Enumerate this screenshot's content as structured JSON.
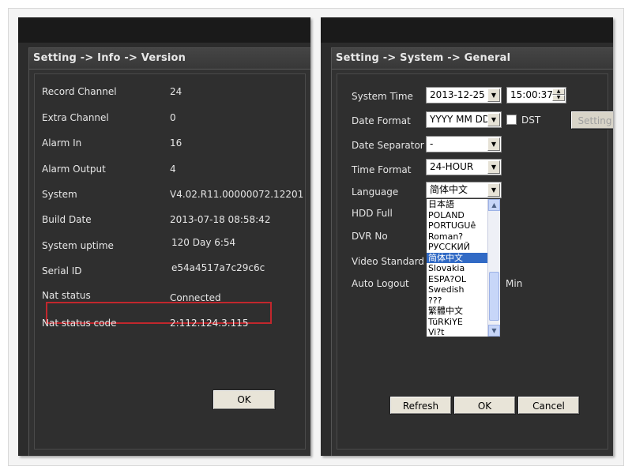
{
  "left_window": {
    "title": "Setting -> Info -> Version",
    "rows": [
      {
        "label": "Record Channel",
        "value": "24"
      },
      {
        "label": "Extra Channel",
        "value": "0"
      },
      {
        "label": "Alarm In",
        "value": "16"
      },
      {
        "label": "Alarm Output",
        "value": "4"
      },
      {
        "label": "System",
        "value": "V4.02.R11.00000072.12201"
      },
      {
        "label": "Build Date",
        "value": "2013-07-18 08:58:42"
      },
      {
        "label": "System uptime",
        "value": "120 Day 6:54"
      },
      {
        "label": "Serial ID",
        "value": "e54a4517a7c29c6c"
      },
      {
        "label": "Nat status",
        "value": "Connected"
      },
      {
        "label": "Nat status code",
        "value": "2:112.124.3.115"
      }
    ],
    "ok_label": "OK",
    "highlight_color": "#c2272d"
  },
  "right_window": {
    "title": "Setting -> System -> General",
    "labels": {
      "system_time": "System Time",
      "date_format": "Date Format",
      "date_separator": "Date Separator",
      "time_format": "Time Format",
      "language": "Language",
      "hdd_full": "HDD Full",
      "dvr_no": "DVR No",
      "video_standard": "Video Standard",
      "auto_logout": "Auto Logout"
    },
    "values": {
      "date": "2013-12-25",
      "time": "15:00:37",
      "date_format": "YYYY MM DD",
      "dst_label": "DST",
      "setting_label": "Setting",
      "date_separator": "-",
      "time_format": "24-HOUR",
      "language": "简体中文",
      "auto_logout_unit": "Min"
    },
    "language_options": [
      "日本語",
      "POLAND",
      "PORTUGUê",
      "Roman?",
      "РУССКИЙ",
      "简体中文",
      "Slovakia",
      "ESPA?OL",
      "Swedish",
      "???",
      "繁體中文",
      "TüRKiYE",
      "Vi?t"
    ],
    "language_selected": "简体中文",
    "buttons": {
      "refresh": "Refresh",
      "ok": "OK",
      "cancel": "Cancel"
    }
  }
}
